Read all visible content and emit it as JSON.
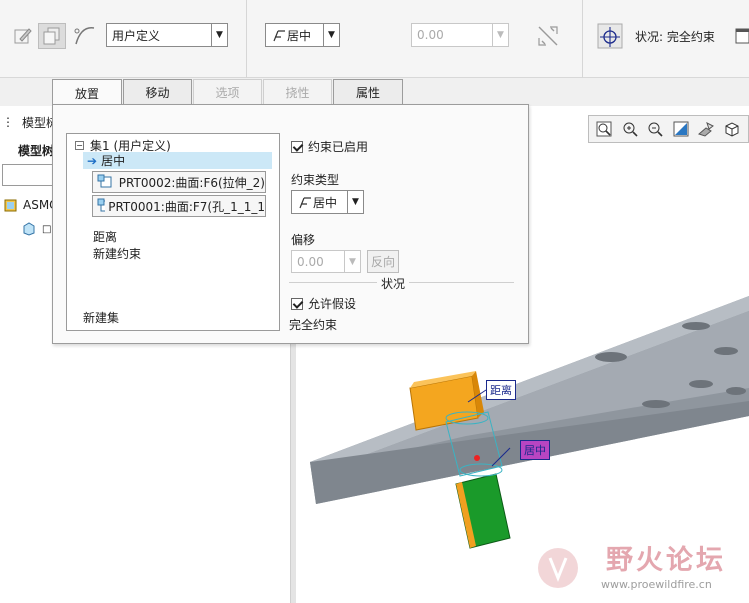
{
  "ribbon": {
    "constraint_set_type": "用户定义",
    "constraint_type": "居中",
    "offset_value": "0.00",
    "status_text": "状况: 完全约束"
  },
  "tabs": [
    {
      "label": "放置"
    },
    {
      "label": "移动"
    },
    {
      "label": "选项"
    },
    {
      "label": "挠性"
    },
    {
      "label": "属性"
    }
  ],
  "tree": {
    "title": "模型树",
    "subtitle": "模型树",
    "root": "ASMO",
    "child": "□"
  },
  "placement": {
    "set_title": "集1 (用户定义)",
    "constraint_selected": "居中",
    "ref_items": [
      {
        "label": "PRT0002:曲面:F6(拉伸_2)"
      },
      {
        "label": "PRT0001:曲面:F7(孔_1_1_1"
      }
    ],
    "distance_label": "距离",
    "new_constraint": "新建约束",
    "new_set": "新建集",
    "constraint_enabled": "约束已启用",
    "constraint_type_label": "约束类型",
    "constraint_type_value": "居中",
    "offset_label": "偏移",
    "offset_value": "0.00",
    "flip_button": "反向",
    "status_group": "状况",
    "allow_assumption": "允许假设",
    "full_constraint": "完全约束"
  },
  "callouts": {
    "distance": "距离",
    "center": "居中"
  },
  "watermark": {
    "title": "野火论坛",
    "url": "www.proewildfire.cn"
  },
  "icons": [
    "edit-definition-icon",
    "copy-icon",
    "curve-icon",
    "constraint-center-icon",
    "flip-icon",
    "move-handle-icon",
    "window-icon",
    "refit-icon",
    "zoom-in-icon",
    "zoom-out-icon",
    "repaint-icon",
    "display-style-icon",
    "view-manager-icon"
  ],
  "colors": {
    "tree_selected": "#cce8f7",
    "plate": "#a8aeb6",
    "bolt_head": "#f4a61f",
    "bolt_shaft": "#1a9a2a",
    "callout_center_bg": "#b845c2"
  }
}
